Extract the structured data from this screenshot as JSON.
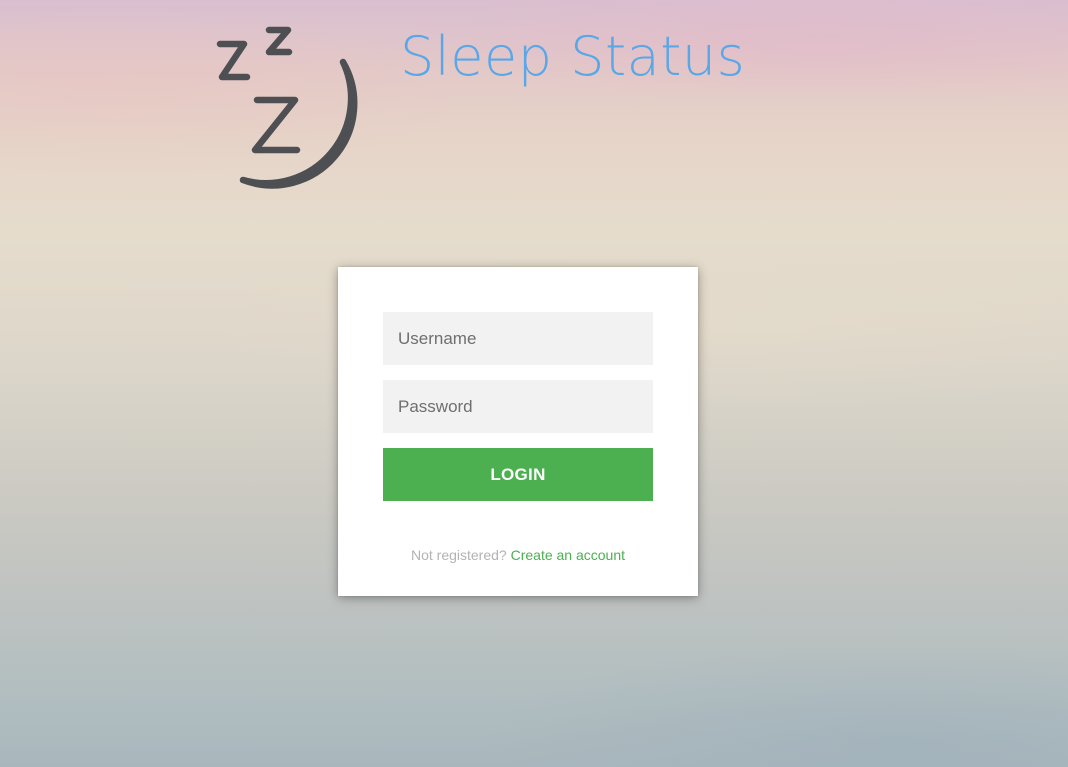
{
  "header": {
    "title": "Sleep Status",
    "logo_icon": "sleeping-moon-icon",
    "title_color": "#5aa7e8"
  },
  "login_form": {
    "username_placeholder": "Username",
    "username_value": "",
    "password_placeholder": "Password",
    "password_value": "",
    "login_label": "LOGIN",
    "not_registered_text": "Not registered?",
    "create_account_label": "Create an account",
    "accent_color": "#4caf50"
  }
}
